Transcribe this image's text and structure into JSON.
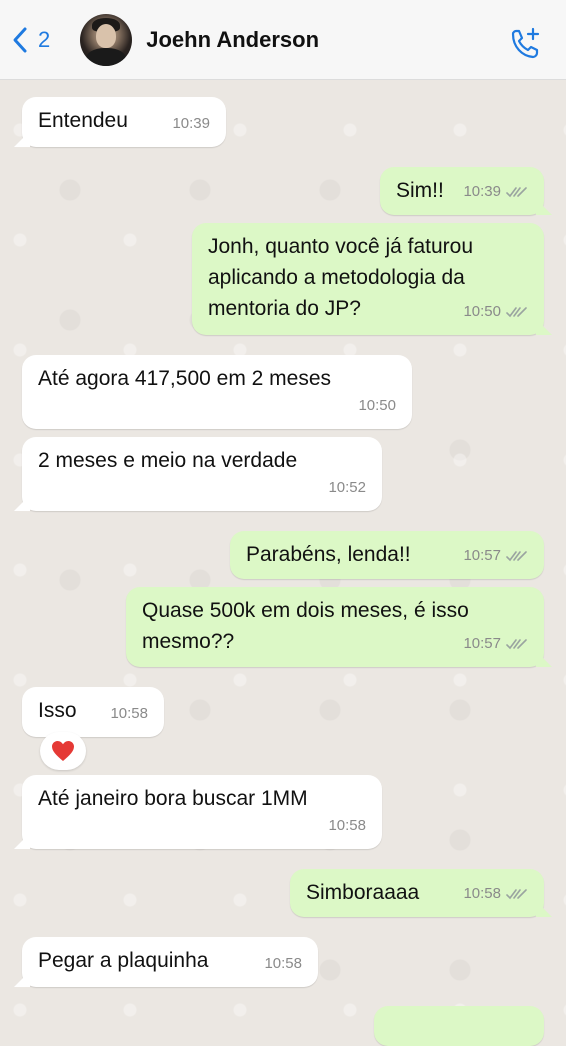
{
  "header": {
    "back_count": "2",
    "contact_name": "Joehn Anderson"
  },
  "messages": [
    {
      "text": "Entendeu",
      "time": "10:39"
    },
    {
      "text": "Sim!!",
      "time": "10:39"
    },
    {
      "text": "Jonh, quanto você já faturou aplicando a metodologia da mentoria do JP?",
      "time": "10:50"
    },
    {
      "text": "Até agora 417,500 em 2 meses",
      "time": "10:50"
    },
    {
      "text": "2 meses e meio na verdade",
      "time": "10:52"
    },
    {
      "text": "Parabéns, lenda!!",
      "time": "10:57"
    },
    {
      "text": "Quase 500k em dois meses, é isso mesmo??",
      "time": "10:57"
    },
    {
      "text": "Isso",
      "time": "10:58",
      "reaction": "heart"
    },
    {
      "text": "Até janeiro bora buscar 1MM",
      "time": "10:58"
    },
    {
      "text": "Simboraaaa",
      "time": "10:58"
    },
    {
      "text": "Pegar a plaquinha",
      "time": "10:58"
    }
  ],
  "colors": {
    "incoming_bubble": "#ffffff",
    "outgoing_bubble": "#dcf8c6",
    "accent": "#1f7ae0",
    "chat_background": "#ebe7e2"
  }
}
